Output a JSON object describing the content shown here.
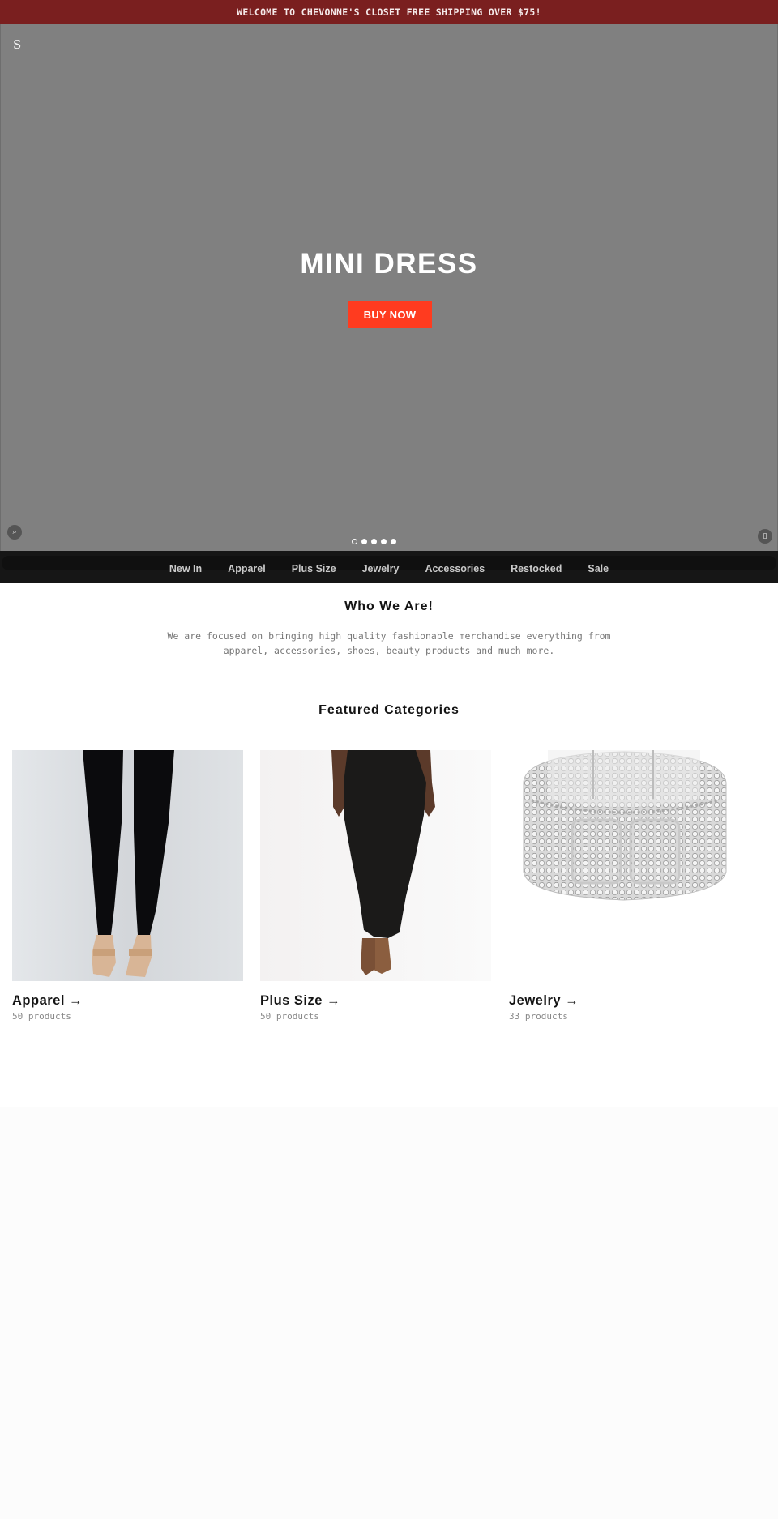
{
  "announcement": "WELCOME TO CHEVONNE'S CLOSET FREE SHIPPING OVER $75!",
  "hero": {
    "logo": "S",
    "title": "MINI DRESS",
    "cta_label": "BUY NOW",
    "left_icon": "search-icon",
    "right_icon": "cart-icon",
    "left_icon_glyph": "⌕",
    "right_icon_glyph": "▯",
    "slides": {
      "count": 5,
      "active_index": 0
    }
  },
  "nav": {
    "items": [
      {
        "label": "New In"
      },
      {
        "label": "Apparel"
      },
      {
        "label": "Plus Size"
      },
      {
        "label": "Jewelry"
      },
      {
        "label": "Accessories"
      },
      {
        "label": "Restocked"
      },
      {
        "label": "Sale"
      }
    ]
  },
  "about": {
    "title": "Who We Are!",
    "text": "We are focused on bringing high quality fashionable merchandise everything from apparel, accessories, shoes, beauty products and much more."
  },
  "featured": {
    "title": "Featured Categories",
    "categories": [
      {
        "title": "Apparel →",
        "count": "50 products",
        "image": "black leggings with nude sandals"
      },
      {
        "title": "Plus Size →",
        "count": "50 products",
        "image": "black maxi bodycon dress"
      },
      {
        "title": "Jewelry →",
        "count": "33 products",
        "image": "silver rhinestone stretch bracelet"
      }
    ]
  },
  "colors": {
    "announcement_bg": "#7a1f1f",
    "hero_bg": "#808080",
    "cta_bg": "#ff3b1f",
    "nav_bg": "#161616"
  }
}
